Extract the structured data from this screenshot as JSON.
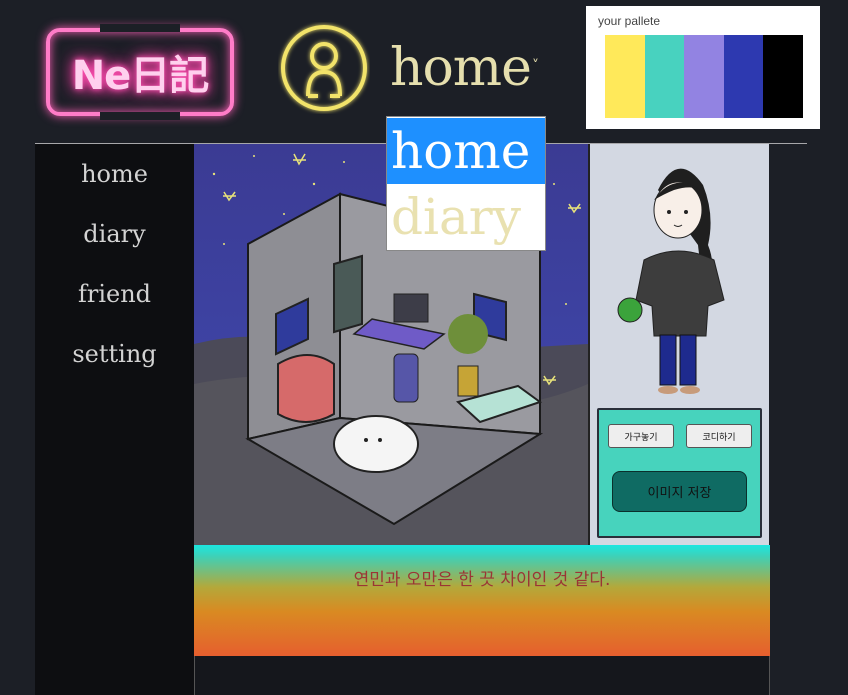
{
  "logo": {
    "text": "Ne日記"
  },
  "header": {
    "nav_title": "home",
    "nav_chevron": "˅"
  },
  "palette": {
    "label": "your pallete",
    "colors": [
      "#ffe95a",
      "#48d2bf",
      "#9283e2",
      "#2d39b0",
      "#000000"
    ]
  },
  "sidebar": {
    "items": [
      {
        "label": "home"
      },
      {
        "label": "diary"
      },
      {
        "label": "friend"
      },
      {
        "label": "setting"
      }
    ]
  },
  "dropdown": {
    "options": [
      {
        "label": "home"
      },
      {
        "label": "diary"
      }
    ],
    "selected": "home"
  },
  "tools": {
    "furniture_button": "가구놓기",
    "outfit_button": "코디하기",
    "save_button": "이미지 저장"
  },
  "message": {
    "text": "연민과 오만은 한 끗 차이인 것 같다."
  }
}
